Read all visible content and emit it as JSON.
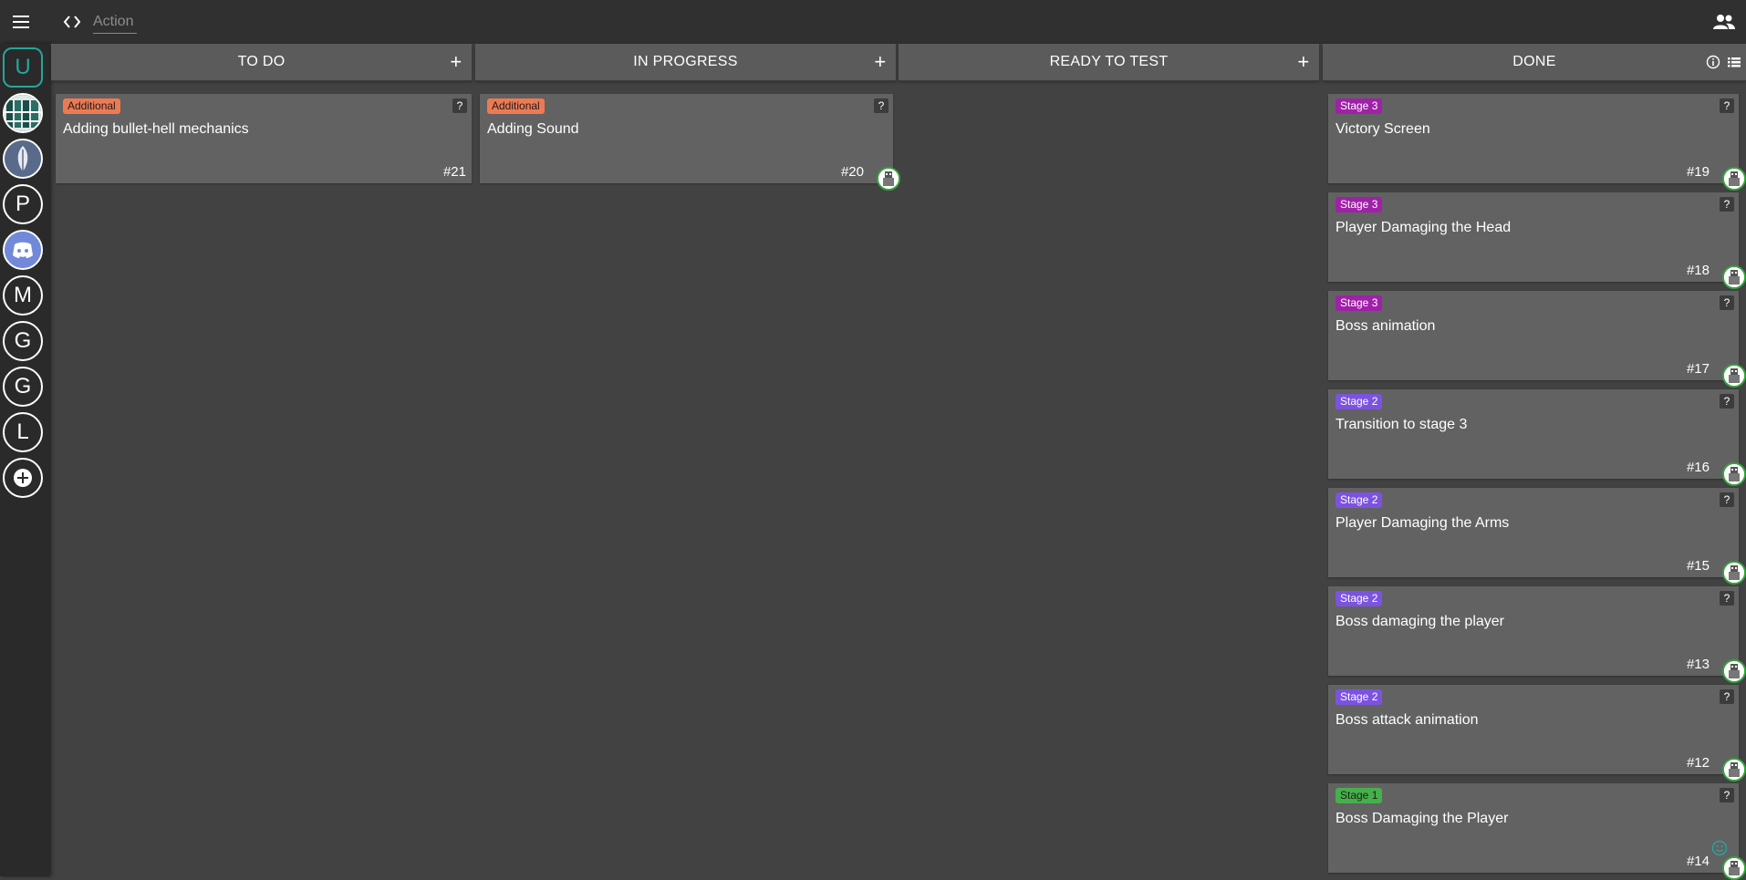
{
  "topbar": {
    "action_placeholder": "Action",
    "menu_icon": "menu-icon",
    "code_icon": "code-icon",
    "people_icon": "people-icon"
  },
  "sidebar": {
    "workspaces": [
      {
        "label": "U",
        "active": true
      },
      {
        "label": "",
        "icon": "bookshelf-icon"
      },
      {
        "label": "",
        "icon": "feather-icon"
      },
      {
        "label": "P"
      },
      {
        "label": "",
        "icon": "discord-icon"
      },
      {
        "label": "M"
      },
      {
        "label": "G"
      },
      {
        "label": "G"
      },
      {
        "label": "L"
      },
      {
        "label": "",
        "icon": "add-circle-icon"
      }
    ]
  },
  "columns": [
    {
      "title": "TO DO",
      "add": "+",
      "cards": [
        {
          "tag": "Additional",
          "title": "Adding bullet-hell mechanics",
          "number": "#21",
          "help": "?"
        }
      ]
    },
    {
      "title": "IN PROGRESS",
      "add": "+",
      "cards": [
        {
          "tag": "Additional",
          "title": "Adding Sound",
          "number": "#20",
          "help": "?"
        }
      ]
    },
    {
      "title": "READY TO TEST",
      "add": "+",
      "cards": []
    },
    {
      "title": "DONE",
      "cards": [
        {
          "tag": "Stage 3",
          "title": "Victory Screen",
          "number": "#19",
          "help": "?"
        },
        {
          "tag": "Stage 3",
          "title": "Player Damaging the Head",
          "number": "#18",
          "help": "?"
        },
        {
          "tag": "Stage 3",
          "title": "Boss animation",
          "number": "#17",
          "help": "?"
        },
        {
          "tag": "Stage 2",
          "title": "Transition to stage 3",
          "number": "#16",
          "help": "?"
        },
        {
          "tag": "Stage 2",
          "title": "Player Damaging the Arms",
          "number": "#15",
          "help": "?"
        },
        {
          "tag": "Stage 2",
          "title": "Boss damaging the player",
          "number": "#13",
          "help": "?"
        },
        {
          "tag": "Stage 2",
          "title": "Boss attack animation",
          "number": "#12",
          "help": "?"
        },
        {
          "tag": "Stage 1",
          "title": "Boss Damaging the Player",
          "number": "#14",
          "help": "?"
        }
      ]
    }
  ],
  "colors": {
    "additional": "#ee7a53",
    "stage3": "#a020a8",
    "stage2": "#7c53e0",
    "stage1": "#46b04a",
    "accent": "#26a69a"
  }
}
